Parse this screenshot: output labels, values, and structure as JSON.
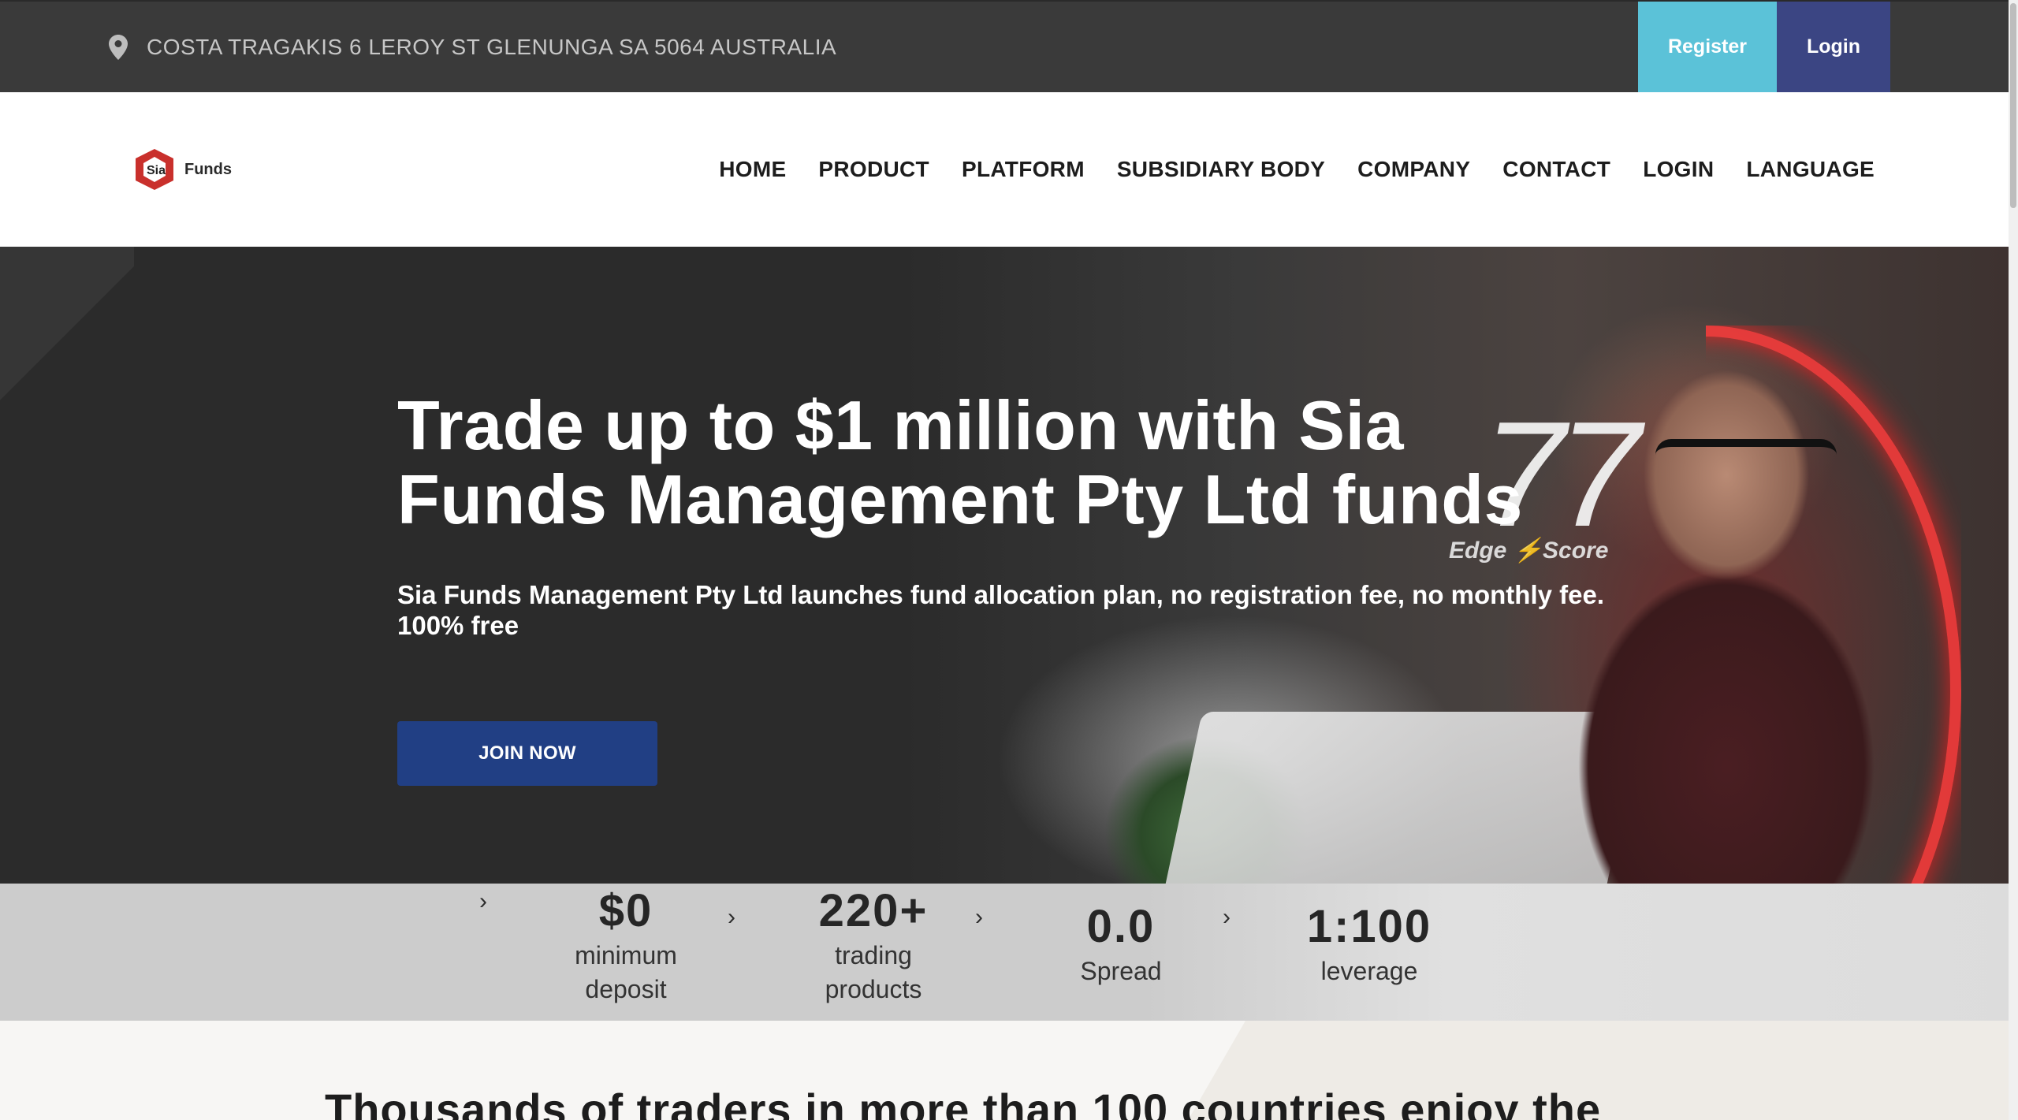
{
  "topbar": {
    "address": "COSTA TRAGAKIS 6 LEROY ST GLENUNGA SA 5064 AUSTRALIA",
    "register_label": "Register",
    "login_label": "Login",
    "register_color": "#5bc2d8",
    "login_color": "#3b4583"
  },
  "logo": {
    "mark_text": "Sia",
    "text": "Funds",
    "accent_color": "#c9302c"
  },
  "nav": {
    "items": [
      "HOME",
      "PRODUCT",
      "PLATFORM",
      "SUBSIDIARY BODY",
      "COMPANY",
      "CONTACT",
      "LOGIN",
      "LANGUAGE"
    ]
  },
  "hero": {
    "title_line1": "Trade up to $1 million with Sia",
    "title_line2": "Funds Management Pty Ltd funds",
    "subtitle_line1": "Sia Funds Management Pty Ltd launches fund allocation plan, no registration fee, no monthly fee.",
    "subtitle_line2": "100% free",
    "cta_label": "JOIN NOW",
    "cta_color": "#213f84",
    "edge_score_value": "77",
    "edge_score_label": "Edge ⚡Score"
  },
  "stats": [
    {
      "value": "$0",
      "label_line1": "minimum",
      "label_line2": "deposit"
    },
    {
      "value": "220+",
      "label_line1": "trading",
      "label_line2": "products"
    },
    {
      "value": "0.0",
      "label_line1": "Spread",
      "label_line2": ""
    },
    {
      "value": "1:100",
      "label_line1": "leverage",
      "label_line2": ""
    }
  ],
  "section": {
    "title": "Thousands of traders in more than 100 countries enjoy the"
  }
}
